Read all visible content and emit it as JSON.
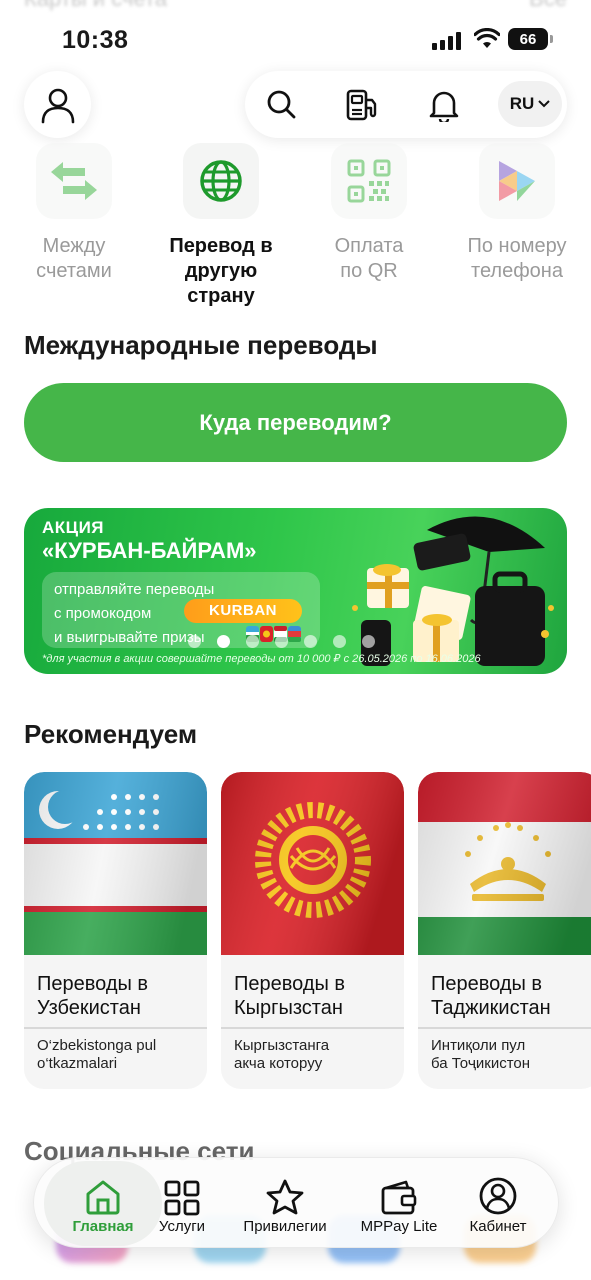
{
  "faded_header": {
    "left": "Карты и счета",
    "right": "Все"
  },
  "status": {
    "time": "10:38",
    "battery": "66"
  },
  "topnav": {
    "language": "RU"
  },
  "quick_actions": [
    {
      "label_1": "Между",
      "label_2": "счетами"
    },
    {
      "label_1": "Перевод в",
      "label_2": "другую страну"
    },
    {
      "label_1": "Оплата",
      "label_2": "по QR"
    },
    {
      "label_1": "По номеру",
      "label_2": "телефона"
    }
  ],
  "international": {
    "title": "Международные переводы",
    "cta": "Куда переводим?"
  },
  "banner": {
    "line1": "АКЦИЯ",
    "line2": "«КУРБАН-БАЙРАМ»",
    "text1": "отправляйте переводы",
    "text2": "с промокодом",
    "promo_code": "KURBAN",
    "text3": "и выигрывайте призы",
    "note": "*для участия в акции совершайте переводы  от 10 000 ₽ с 26.05.2026 по 16.06.2026"
  },
  "recommended": {
    "title": "Рекомендуем",
    "cards": [
      {
        "title_1": "Переводы в",
        "title_2": "Узбекистан",
        "sub_1": "O‘zbekistonga pul",
        "sub_2": "o‘tkazmalari"
      },
      {
        "title_1": "Переводы в",
        "title_2": "Кыргызстан",
        "sub_1": "Кыргызстанга",
        "sub_2": "акча которуу"
      },
      {
        "title_1": "Переводы в",
        "title_2": "Таджикистан",
        "sub_1": "Интиқоли пул",
        "sub_2": "ба Тоҷикистон"
      }
    ]
  },
  "social": {
    "title": "Социальные сети"
  },
  "tabbar": [
    {
      "label": "Главная"
    },
    {
      "label": "Услуги"
    },
    {
      "label": "Привилегии"
    },
    {
      "label": "MPPay Lite"
    },
    {
      "label": "Кабинет"
    }
  ],
  "colors": {
    "accent": "#45b649",
    "active_tab": "#2f9e3a"
  }
}
